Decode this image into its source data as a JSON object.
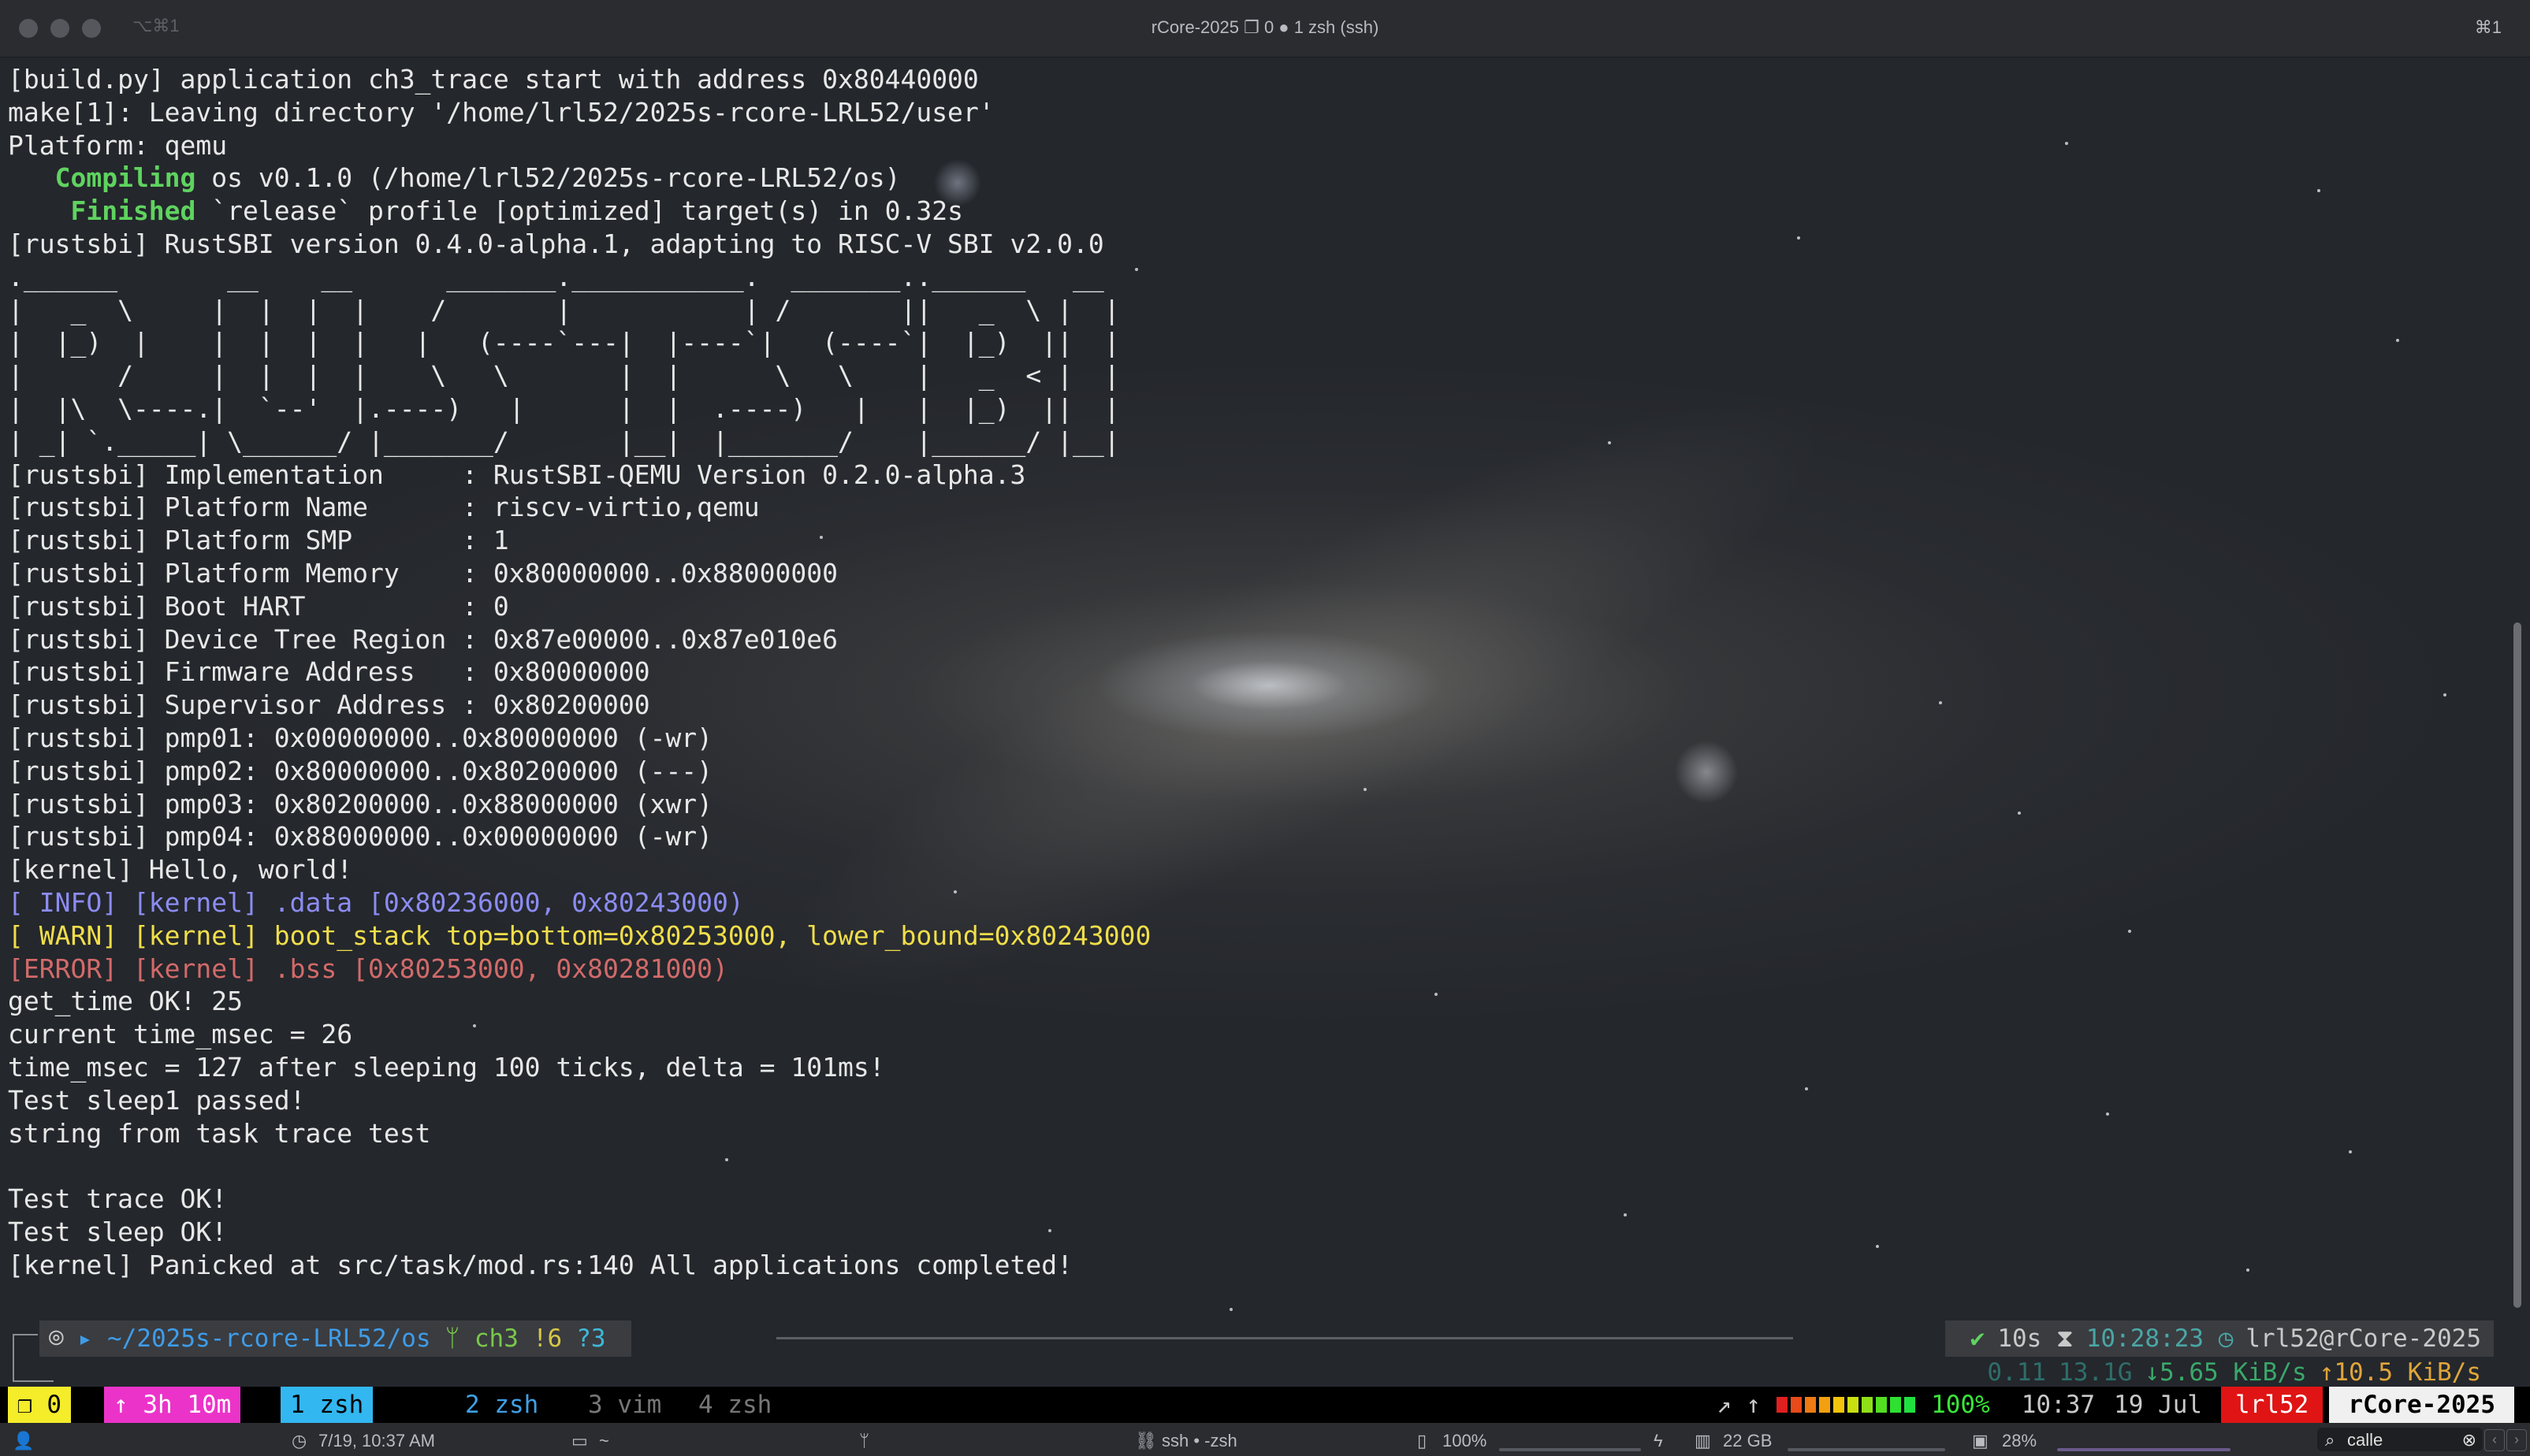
{
  "window": {
    "title": "rCore-2025 ❐ 0 ● 1 zsh (ssh)",
    "left_shortcut": "⌥⌘1",
    "right_shortcut": "⌘1"
  },
  "terminal_lines": [
    "[build.py] application ch3_trace start with address 0x80440000",
    "make[1]: Leaving directory '/home/lrl52/2025s-rcore-LRL52/user'",
    "Platform: qemu",
    "   Compiling os v0.1.0 (/home/lrl52/2025s-rcore-LRL52/os)",
    "    Finished `release` profile [optimized] target(s) in 0.32s",
    "[rustsbi] RustSBI version 0.4.0-alpha.1, adapting to RISC-V SBI v2.0.0",
    ".______       __    __      _______.___________.  _______..______   __",
    "|   _  \\     |  |  |  |    /       |           | /       ||   _  \\ |  |",
    "|  |_)  |    |  |  |  |   |   (----`---|  |----`|   (----`|  |_)  ||  |",
    "|      /     |  |  |  |    \\   \\       |  |      \\   \\    |   _  < |  |",
    "|  |\\  \\----.|  `--'  |.----)   |      |  |  .----)   |   |  |_)  ||  |",
    "| _| `._____| \\______/ |_______/       |__|  |_______/    |______/ |__|",
    "[rustsbi] Implementation     : RustSBI-QEMU Version 0.2.0-alpha.3",
    "[rustsbi] Platform Name      : riscv-virtio,qemu",
    "[rustsbi] Platform SMP       : 1",
    "[rustsbi] Platform Memory    : 0x80000000..0x88000000",
    "[rustsbi] Boot HART          : 0",
    "[rustsbi] Device Tree Region : 0x87e00000..0x87e010e6",
    "[rustsbi] Firmware Address   : 0x80000000",
    "[rustsbi] Supervisor Address : 0x80200000",
    "[rustsbi] pmp01: 0x00000000..0x80000000 (-wr)",
    "[rustsbi] pmp02: 0x80000000..0x80200000 (---)",
    "[rustsbi] pmp03: 0x80200000..0x88000000 (xwr)",
    "[rustsbi] pmp04: 0x88000000..0x00000000 (-wr)",
    "[kernel] Hello, world!",
    "[ INFO] [kernel] .data [0x80236000, 0x80243000)",
    "[ WARN] [kernel] boot_stack top=bottom=0x80253000, lower_bound=0x80243000",
    "[ERROR] [kernel] .bss [0x80253000, 0x80281000)",
    "get_time OK! 25",
    "current time_msec = 26",
    "time_msec = 127 after sleeping 100 ticks, delta = 101ms!",
    "Test sleep1 passed!",
    "string from task trace test",
    "",
    "Test trace OK!",
    "Test sleep OK!",
    "[kernel] Panicked at src/task/mod.rs:140 All applications completed!"
  ],
  "prompt": {
    "os_icon": "⌾",
    "dir": "▸ ~/2025s-rcore-LRL52/os",
    "git_branch": "ᛘ ch3",
    "git_modified": "!6",
    "git_untracked": "?3",
    "status_ok": "✔",
    "duration": "10s ⧗",
    "clock": "10:28:23 ◷",
    "user_host": "lrl52@rCore-2025",
    "load": "0.11",
    "ram": "13.1G",
    "net_down": "↓5.65 KiB/s",
    "net_up": "↑10.5 KiB/s"
  },
  "tmux": {
    "session_zero": "❐ 0",
    "uptime": "↑ 3h 10m",
    "windows": [
      "1 zsh",
      "2 zsh",
      "3 vim",
      "4 zsh"
    ],
    "arrows": "↗ ↑",
    "battery_pct": "100%",
    "battery_level": 1.0,
    "battery_colors": [
      "#e02020",
      "#e84a1a",
      "#ee7a14",
      "#f2a010",
      "#f4c40c",
      "#c8e010",
      "#8ee018",
      "#52e020",
      "#2ee030",
      "#20e040"
    ],
    "time": "10:37",
    "date": "19 Jul",
    "user": "lrl52",
    "host": "rCore-2025"
  },
  "system_bar": {
    "datetime": "7/19, 10:37 AM",
    "folder": "~",
    "ssh_label": "ssh • -zsh",
    "battery": "100%",
    "memory": "22 GB",
    "cpu": "28%",
    "search_value": "calle"
  },
  "colors": {
    "accent_blue": "#33b7f0",
    "magenta": "#ec33c9",
    "yellow": "#f5ec2a",
    "red": "#e01414"
  }
}
